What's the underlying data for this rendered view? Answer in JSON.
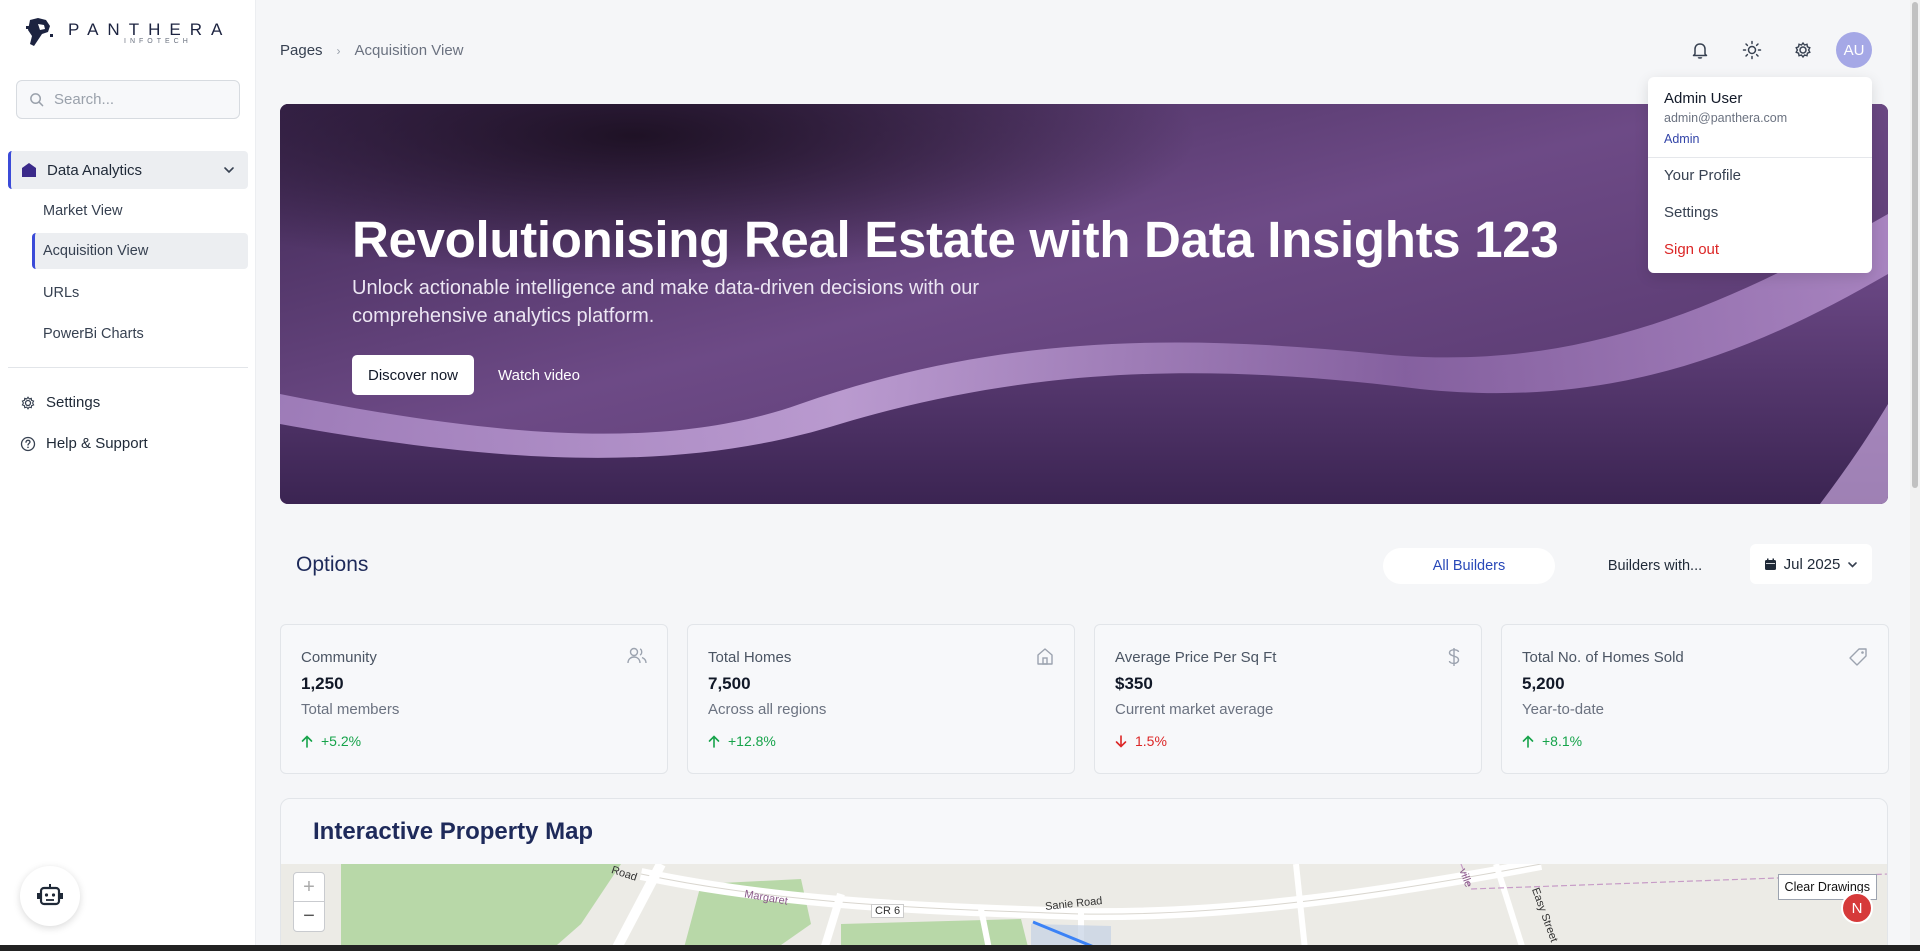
{
  "brand": {
    "name": "PANTHERA",
    "sub": "INFOTECH"
  },
  "search": {
    "placeholder": "Search..."
  },
  "sidebar": {
    "group_label": "Data Analytics",
    "sub_items": [
      {
        "label": "Market View"
      },
      {
        "label": "Acquisition View"
      },
      {
        "label": "URLs"
      },
      {
        "label": "PowerBi Charts"
      }
    ],
    "settings_label": "Settings",
    "help_label": "Help & Support"
  },
  "breadcrumb": {
    "root": "Pages",
    "current": "Acquisition View"
  },
  "user": {
    "initials": "AU",
    "name": "Admin User",
    "email": "admin@panthera.com",
    "role": "Admin"
  },
  "user_menu": {
    "profile": "Your Profile",
    "settings": "Settings",
    "signout": "Sign out"
  },
  "hero": {
    "title": "Revolutionising Real Estate with Data Insights 123",
    "subtitle": "Unlock actionable intelligence and make data-driven decisions with our comprehensive analytics platform.",
    "primary_cta": "Discover now",
    "secondary_cta": "Watch video"
  },
  "options": {
    "title": "Options",
    "filter_all": "All Builders",
    "filter_builders": "Builders with...",
    "date": "Jul 2025"
  },
  "stats": [
    {
      "title": "Community",
      "value": "1,250",
      "desc": "Total members",
      "change": "+5.2%",
      "direction": "up",
      "icon": "users-icon"
    },
    {
      "title": "Total Homes",
      "value": "7,500",
      "desc": "Across all regions",
      "change": "+12.8%",
      "direction": "up",
      "icon": "home-icon"
    },
    {
      "title": "Average Price Per Sq Ft",
      "value": "$350",
      "desc": "Current market average",
      "change": "1.5%",
      "direction": "down",
      "icon": "dollar-icon"
    },
    {
      "title": "Total No. of Homes Sold",
      "value": "5,200",
      "desc": "Year-to-date",
      "change": "+8.1%",
      "direction": "up",
      "icon": "tag-icon"
    }
  ],
  "map": {
    "title": "Interactive Property Map",
    "zoom_in": "+",
    "zoom_out": "−",
    "clear_label": "Clear Drawings",
    "badge": "N",
    "roads": [
      "Road",
      "Margaret",
      "CR 6",
      "Sanie Road",
      "Easy Street",
      "ville"
    ]
  },
  "colors": {
    "accent": "#3b4bd8",
    "hero_bg": "#4a2f63",
    "success": "#16a34a",
    "danger": "#dc2626",
    "avatar": "#a5a8e6"
  }
}
